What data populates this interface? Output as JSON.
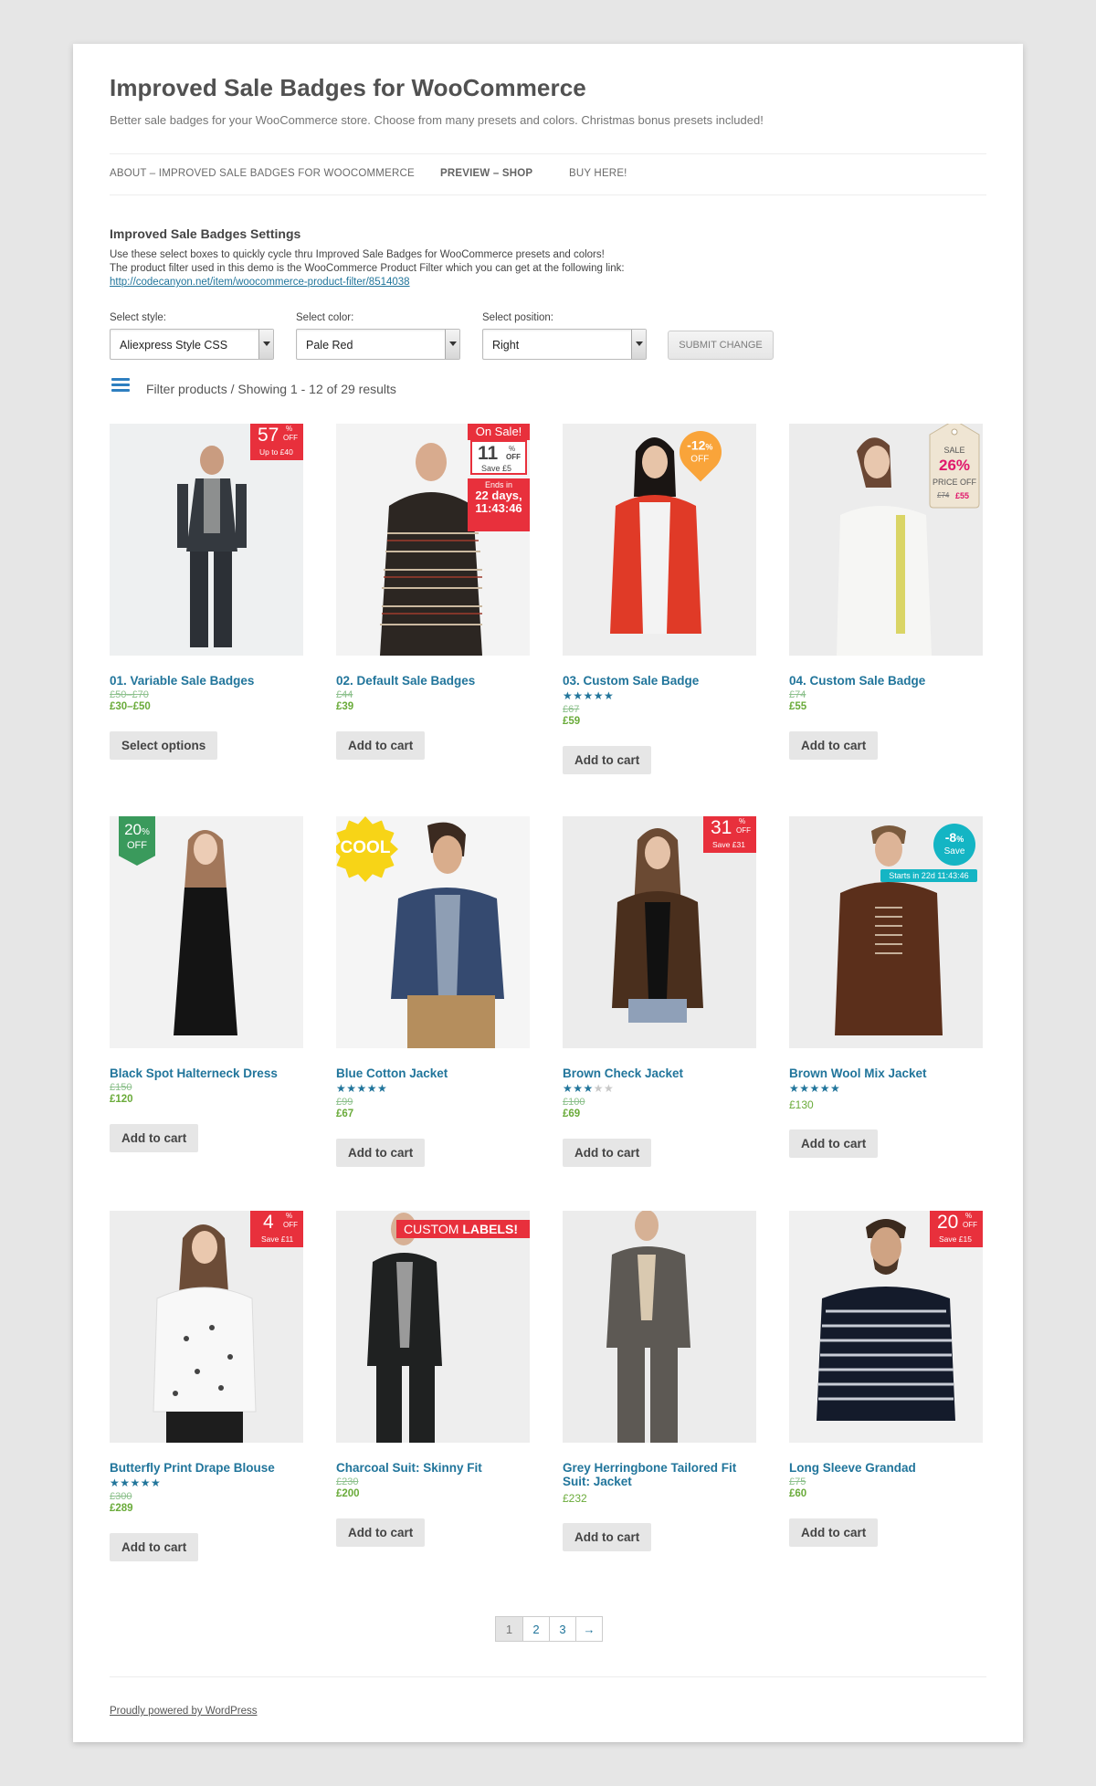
{
  "site": {
    "title": "Improved Sale Badges for WooCommerce",
    "description": "Better sale badges for your WooCommerce store. Choose from many presets and colors. Christmas bonus presets included!"
  },
  "nav": {
    "items": [
      {
        "label": "About – Improved Sale Badges for WooCommerce"
      },
      {
        "label": "Preview – Shop"
      },
      {
        "label": "Buy Here!"
      }
    ]
  },
  "settings": {
    "title": "Improved Sale Badges Settings",
    "line1": "Use these select boxes to quickly cycle thru Improved Sale Badges for WooCommerce presets and colors!",
    "line2": "The product filter used in this demo is the WooCommerce Product Filter which you can get at the following link:",
    "link": "http://codecanyon.net/item/woocommerce-product-filter/8514038",
    "style_label": "Select style:",
    "style_value": "Aliexpress Style CSS",
    "color_label": "Select color:",
    "color_value": "Pale Red",
    "position_label": "Select position:",
    "position_value": "Right",
    "submit_label": "Submit Change"
  },
  "filter": {
    "text": "Filter products / Showing 1 - 12 of 29 results"
  },
  "products": [
    {
      "name": "01. Variable Sale Badges",
      "old": "£50–£70",
      "new": "£30–£50",
      "button": "Select options"
    },
    {
      "name": "02. Default Sale Badges",
      "old": "£44",
      "new": "£39",
      "button": "Add to cart"
    },
    {
      "name": "03. Custom Sale Badge",
      "rating": 5,
      "old": "£67",
      "new": "£59",
      "button": "Add to cart"
    },
    {
      "name": "04. Custom Sale Badge",
      "old": "£74",
      "new": "£55",
      "button": "Add to cart"
    },
    {
      "name": "Black Spot Halterneck Dress",
      "old": "£150",
      "new": "£120",
      "button": "Add to cart"
    },
    {
      "name": "Blue Cotton Jacket",
      "rating": 5,
      "old": "£99",
      "new": "£67",
      "button": "Add to cart"
    },
    {
      "name": "Brown Check Jacket",
      "rating": 3,
      "old": "£100",
      "new": "£69",
      "button": "Add to cart"
    },
    {
      "name": "Brown Wool Mix Jacket",
      "rating": 5,
      "price": "£130",
      "button": "Add to cart"
    },
    {
      "name": "Butterfly Print Drape Blouse",
      "rating": 5,
      "old": "£300",
      "new": "£289",
      "button": "Add to cart"
    },
    {
      "name": "Charcoal Suit: Skinny Fit",
      "old": "£230",
      "new": "£200",
      "button": "Add to cart"
    },
    {
      "name": "Grey Herringbone Tailored Fit Suit: Jacket",
      "price": "£232",
      "button": "Add to cart"
    },
    {
      "name": "Long Sleeve Grandad",
      "old": "£75",
      "new": "£60",
      "button": "Add to cart"
    }
  ],
  "badges": {
    "b1": {
      "pct": "57",
      "sup": "%",
      "off": "OFF",
      "sub": "Up to £40"
    },
    "b2": {
      "top": "On Sale!",
      "num": "11",
      "sup": "%",
      "off": "OFF",
      "save": "Save £5",
      "ends": "Ends in",
      "days": "22 days,",
      "time": "11:43:46"
    },
    "b3": {
      "pct": "-12",
      "sup": "%",
      "off": "OFF"
    },
    "b4": {
      "sale": "SALE",
      "pct": "26%",
      "price_off": "PRICE OFF",
      "old": "£74",
      "new": "£55"
    },
    "b5": {
      "pct": "20",
      "sup": "%",
      "off": "OFF"
    },
    "b6": {
      "text": "COOL"
    },
    "b7": {
      "pct": "31",
      "sup": "%",
      "off": "OFF",
      "sub": "Save £31"
    },
    "b8": {
      "pct": "-8",
      "sup": "%",
      "save": "Save",
      "starts": "Starts in 22d 11:43:46"
    },
    "b9": {
      "pct": "4",
      "sup": "%",
      "off": "OFF",
      "sub": "Save £11"
    },
    "b10": {
      "text1": "CUSTOM ",
      "text2": "LABELS!"
    },
    "b12": {
      "pct": "20",
      "sup": "%",
      "off": "OFF",
      "sub": "Save £15"
    }
  },
  "pagination": {
    "pages": [
      "1",
      "2",
      "3",
      "→"
    ]
  },
  "footer": {
    "text": "Proudly powered by WordPress"
  },
  "colors": {
    "link": "#21759b",
    "sale_red": "#e8303c",
    "price_green": "#6aab3a",
    "badge_orange": "#f9a43a",
    "badge_teal": "#14b5c4",
    "badge_green": "#3a9a5c",
    "badge_yellow": "#f7d417",
    "badge_pink": "#e0186c"
  }
}
